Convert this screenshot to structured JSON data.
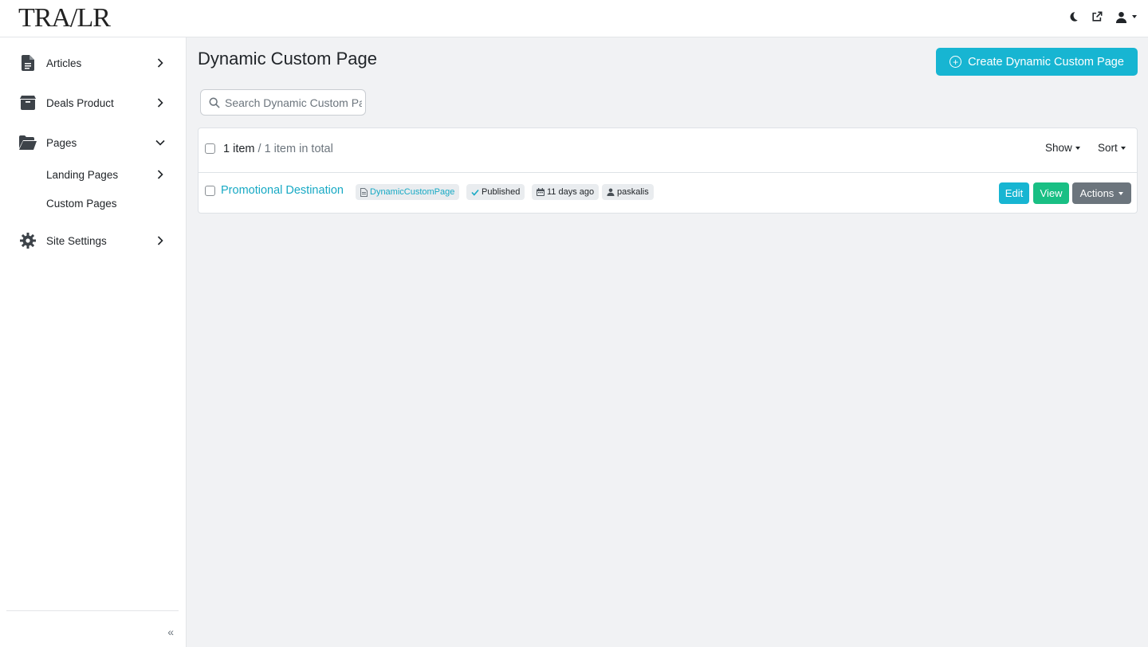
{
  "app": {
    "logo_text": "TRA/LR"
  },
  "sidebar": {
    "items": [
      {
        "label": "Articles",
        "icon": "document-icon"
      },
      {
        "label": "Deals Product",
        "icon": "box-icon"
      },
      {
        "label": "Pages",
        "icon": "folder-open-icon",
        "expanded": true,
        "children": [
          {
            "label": "Landing Pages"
          },
          {
            "label": "Custom Pages"
          }
        ]
      },
      {
        "label": "Site Settings",
        "icon": "gear-icon"
      }
    ],
    "collapse_glyph": "«"
  },
  "main": {
    "title": "Dynamic Custom Page",
    "create_button_label": "Create Dynamic Custom Page",
    "search_placeholder": "Search Dynamic Custom Page",
    "list": {
      "count": "1 item",
      "total": " / 1 item in total",
      "show_label": "Show",
      "sort_label": "Sort",
      "rows": [
        {
          "title": "Promotional Destination",
          "type": "DynamicCustomPage",
          "status": "Published",
          "date": "11 days ago",
          "author": "paskalis",
          "edit_label": "Edit",
          "view_label": "View",
          "actions_label": "Actions"
        }
      ]
    }
  },
  "colors": {
    "accent": "#17b5d2",
    "success": "#19bf84",
    "secondary": "#6c757d",
    "link": "#17a9c4"
  }
}
